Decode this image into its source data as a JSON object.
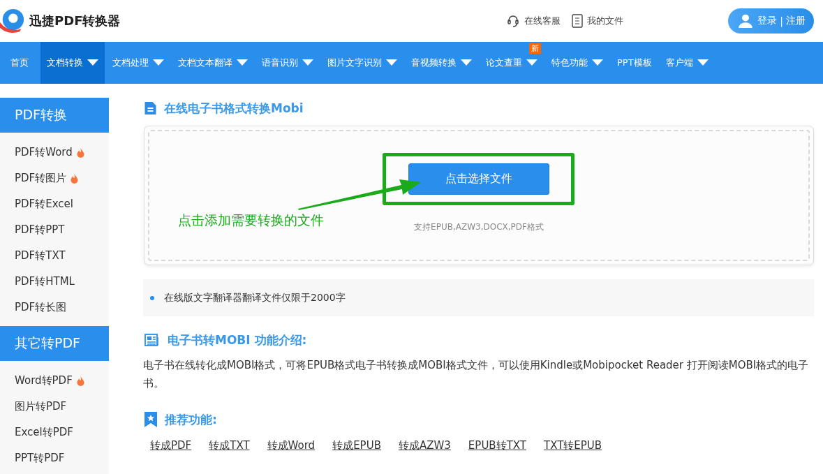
{
  "header": {
    "logo_text": "迅捷PDF转换器",
    "links": [
      {
        "kind": "headset",
        "label": "在线客服"
      },
      {
        "kind": "file",
        "label": "我的文件"
      }
    ],
    "account": {
      "login": "登录",
      "separator": "|",
      "register": "注册"
    }
  },
  "nav": [
    {
      "label": "首页",
      "selected": false,
      "dropdown": false
    },
    {
      "label": "文档转换",
      "selected": true,
      "dropdown": true
    },
    {
      "label": "文档处理",
      "selected": false,
      "dropdown": true
    },
    {
      "label": "文档文本翻译",
      "selected": false,
      "dropdown": true
    },
    {
      "label": "语音识别",
      "selected": false,
      "dropdown": true
    },
    {
      "label": "图片文字识别",
      "selected": false,
      "dropdown": true
    },
    {
      "label": "音视频转换",
      "selected": false,
      "dropdown": true
    },
    {
      "label": "论文查重",
      "selected": false,
      "dropdown": true,
      "badge": "新"
    },
    {
      "label": "特色功能",
      "selected": false,
      "dropdown": true
    },
    {
      "label": "PPT模板",
      "selected": false,
      "dropdown": false
    },
    {
      "label": "客户端",
      "selected": false,
      "dropdown": true
    }
  ],
  "sidebar": [
    {
      "heading": "PDF转换",
      "items": [
        {
          "label": "PDF转Word",
          "hot": true
        },
        {
          "label": "PDF转图片",
          "hot": true
        },
        {
          "label": "PDF转Excel",
          "hot": false
        },
        {
          "label": "PDF转PPT",
          "hot": false
        },
        {
          "label": "PDF转TXT",
          "hot": false
        },
        {
          "label": "PDF转HTML",
          "hot": false
        },
        {
          "label": "PDF转长图",
          "hot": false
        }
      ]
    },
    {
      "heading": "其它转PDF",
      "items": [
        {
          "label": "Word转PDF",
          "hot": true
        },
        {
          "label": "图片转PDF",
          "hot": false
        },
        {
          "label": "Excel转PDF",
          "hot": false
        },
        {
          "label": "PPT转PDF",
          "hot": false
        }
      ]
    }
  ],
  "main": {
    "title": "在线电子书格式转换Mobi",
    "upload": {
      "button": "点击选择文件",
      "hint": "支持EPUB,AZW3,DOCX,PDF格式",
      "annotation": "点击添加需要转换的文件"
    },
    "notes": [
      "在线版文字翻译器翻译文件仅限于2000字"
    ],
    "intro": {
      "heading": "电子书转MOBI 功能介绍:",
      "text": "电子书在线转化成MOBI格式，可将EPUB格式电子书转换成MOBI格式文件，可以使用Kindle或Mobipocket Reader 打开阅读MOBI格式的电子书。"
    },
    "recommend": {
      "heading": "推荐功能:",
      "links": [
        "转成PDF",
        "转成TXT",
        "转成Word",
        "转成EPUB",
        "转成AZW3",
        "EPUB转TXT",
        "TXT转EPUB"
      ]
    }
  }
}
